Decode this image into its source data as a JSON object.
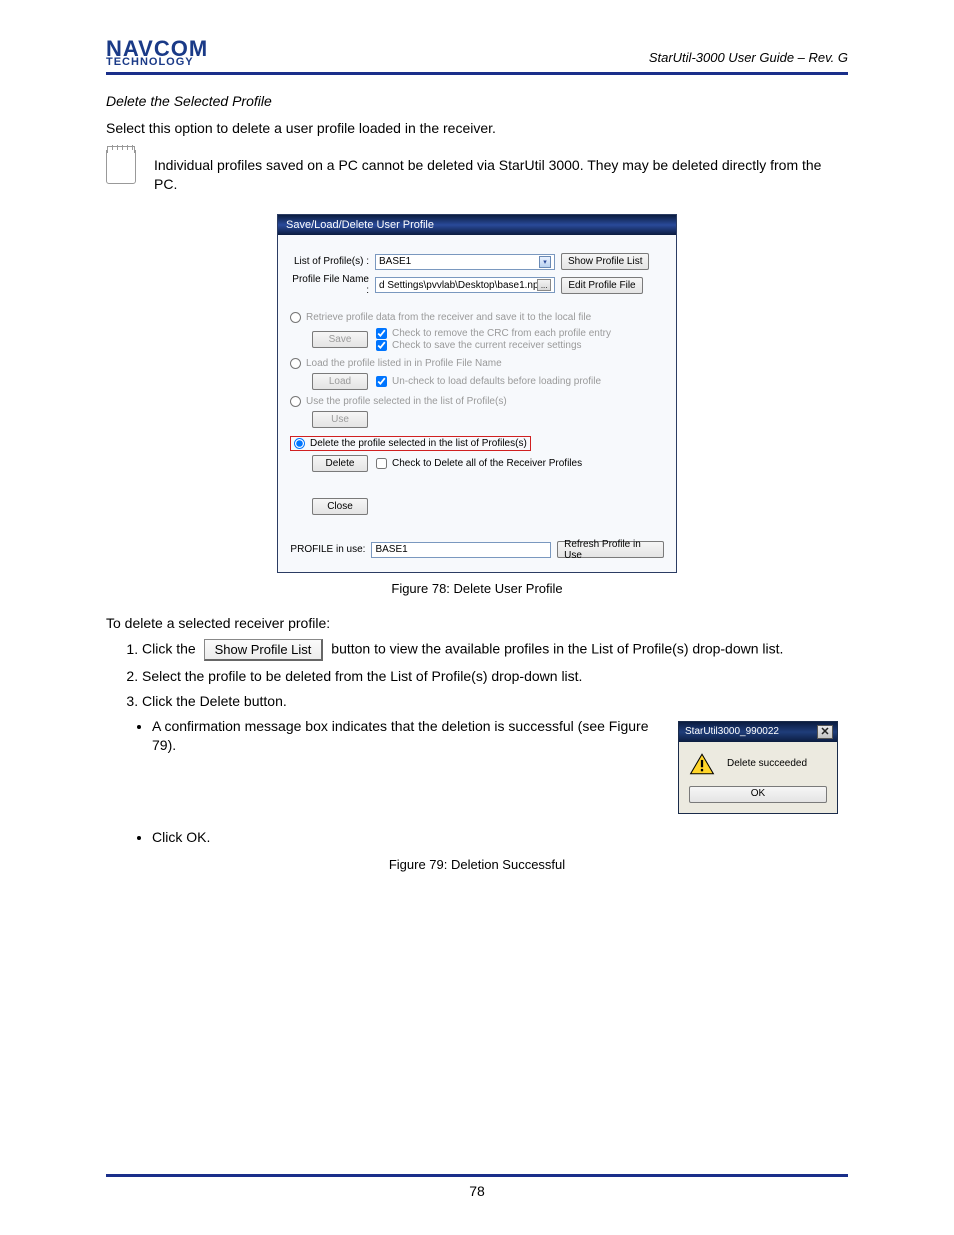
{
  "header": {
    "logo_line1": "NAVCOM",
    "logo_line2": "TECHNOLOGY",
    "doc_title_l1": "StarUtil-3000 User Guide – Rev. G",
    "doc_title_l2": ""
  },
  "section": {
    "heading": "Delete the Selected Profile",
    "intro": "Select this option to delete a user profile loaded in the receiver.",
    "note": "Individual profiles saved on a PC cannot be deleted via StarUtil 3000. They may be deleted directly from the PC."
  },
  "fig78": {
    "caption": "Figure 78: Delete User Profile",
    "dlg_title": "Save/Load/Delete User Profile",
    "list_label": "List of Profile(s) :",
    "list_value": "BASE1",
    "show_list_btn": "Show Profile List",
    "file_label": "Profile File Name :",
    "file_value": "d Settings\\pvvlab\\Desktop\\base1.npt",
    "edit_file_btn": "Edit Profile File",
    "opt_retrieve": "Retrieve profile data from the receiver and save it to the local file",
    "save_btn": "Save",
    "chk_crc": "Check to remove the CRC from each profile entry",
    "chk_save_current": "Check to save the current receiver settings",
    "opt_load": "Load the profile listed in in Profile File Name",
    "load_btn": "Load",
    "chk_uncheck_defaults": "Un-check to load defaults before loading profile",
    "opt_use": "Use the profile selected in the list of Profile(s)",
    "use_btn": "Use",
    "opt_delete": "Delete the profile selected in the list of Profiles(s)",
    "delete_btn": "Delete",
    "chk_delete_all": "Check to Delete all of the Receiver Profiles",
    "close_btn": "Close",
    "profile_inuse_label": "PROFILE in use:",
    "profile_inuse_value": "BASE1",
    "refresh_btn": "Refresh Profile in Use"
  },
  "steps_head": "To delete a selected receiver profile:",
  "step1_a": "Click the ",
  "step1_b": " button to view the available profiles in the List of Profile(s) drop-down list.",
  "step2": "Select the profile to be deleted from the List of Profile(s) drop-down list.",
  "step3": "Click the Delete button.",
  "bullet1": "A confirmation message box indicates that the deletion is successful (see Figure 79).",
  "bullet2": "Click OK.",
  "fig79": {
    "dlg_title": "StarUtil3000_990022",
    "msg": "Delete succeeded",
    "ok_btn": "OK",
    "caption": "Figure 79: Deletion Successful"
  },
  "inline_btn": "Show Profile List",
  "footer": {
    "page": "78"
  }
}
